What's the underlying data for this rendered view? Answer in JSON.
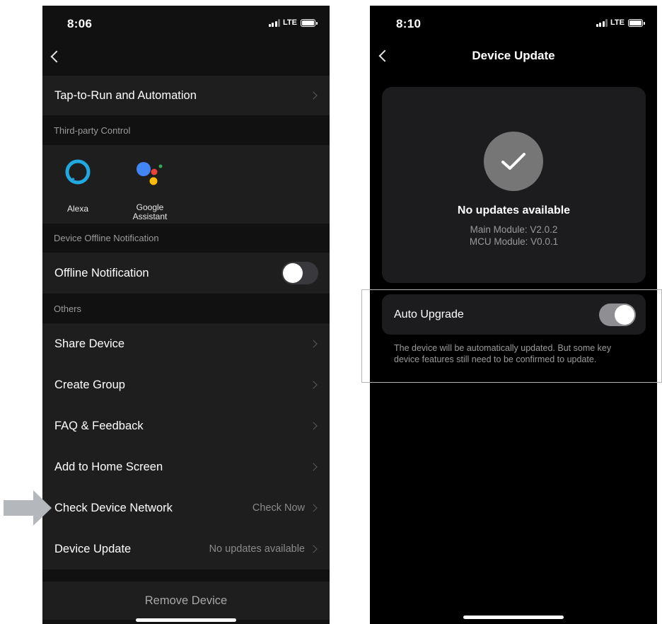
{
  "left": {
    "status": {
      "time": "8:06",
      "network": "LTE"
    },
    "tap_to_run": "Tap-to-Run and Automation",
    "section_third_party": "Third-party Control",
    "alexa_label": "Alexa",
    "google_label_line1": "Google",
    "google_label_line2": "Assistant",
    "section_offline": "Device Offline Notification",
    "offline_notification": {
      "label": "Offline Notification",
      "enabled": false
    },
    "section_others": "Others",
    "share_device": "Share Device",
    "create_group": "Create Group",
    "faq": "FAQ & Feedback",
    "add_home": "Add to Home Screen",
    "check_network": {
      "label": "Check Device Network",
      "value": "Check Now"
    },
    "device_update": {
      "label": "Device Update",
      "value": "No updates available"
    },
    "remove_device": "Remove Device"
  },
  "right": {
    "status": {
      "time": "8:10",
      "network": "LTE"
    },
    "title": "Device Update",
    "no_updates": "No updates available",
    "main_module": "Main Module: V2.0.2",
    "mcu_module": "MCU Module: V0.0.1",
    "auto_upgrade": {
      "label": "Auto Upgrade",
      "enabled": true
    },
    "auto_desc": "The device will be automatically updated. But some key device features still need to be confirmed to update."
  },
  "colors": {
    "toggle_off_track": "#39393d",
    "toggle_on_track": "#8e8e93",
    "arrow": "#b4b7bb",
    "alexa": "#22a8e0"
  },
  "icons": {
    "alexa": "alexa-ring-icon",
    "google": "google-assistant-dots-icon",
    "check": "checkmark-icon",
    "back": "chevron-left-icon",
    "row": "chevron-right-icon"
  }
}
